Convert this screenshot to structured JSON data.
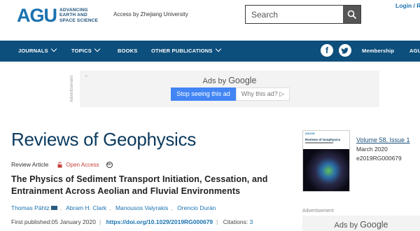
{
  "header": {
    "logo_mark": "AGU",
    "logo_text_lines": [
      "ADVANCING",
      "EARTH AND",
      "SPACE SCIENCE"
    ],
    "access_text": "Access by Zhejiang University",
    "search_placeholder": "Search",
    "login_text": "Login / Re"
  },
  "nav": {
    "items": [
      "JOURNALS",
      "TOPICS",
      "BOOKS",
      "OTHER PUBLICATIONS"
    ],
    "membership": "Membership",
    "trailing": "AGU",
    "social": [
      "facebook-icon",
      "twitter-icon"
    ],
    "background_color": "#0d4f7c"
  },
  "ad": {
    "label": "Advertisement",
    "ads_by": "Ads by",
    "google": "Google",
    "stop_button": "Stop seeing this ad",
    "why_button": "Why this ad? ▷"
  },
  "journal": {
    "title": "Reviews of Geophysics"
  },
  "article": {
    "type": "Review Article",
    "open_access": "Open Access",
    "title": "The Physics of Sediment Transport Initiation, Cessation, and Entrainment Across Aeolian and Fluvial Environments",
    "authors": [
      "Thomas Pähtz",
      "Abram H. Clark",
      "Manousos Valyrakis",
      "Orencio Durán"
    ],
    "first_published_label": "First published:",
    "first_published_date": "05 January 2020",
    "doi": "https://doi.org/10.1029/2019RG000679",
    "citations_label": "Citations:",
    "citations": "3"
  },
  "issue": {
    "cover_brand": "AGU100",
    "cover_title": "Reviews of Geophysics",
    "volume_link": "Volume 58, Issue 1",
    "date": "March 2020",
    "id": "e2019RG000679"
  },
  "sidebar_ad": {
    "label": "Advertisement",
    "ads_by": "Ads by",
    "google": "Google"
  }
}
